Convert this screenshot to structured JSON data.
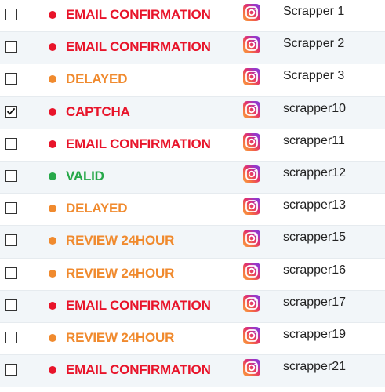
{
  "colors": {
    "red": "#e8142a",
    "orange": "#f08a2e",
    "green": "#27a84a"
  },
  "rows": [
    {
      "checked": false,
      "status": "EMAIL CONFIRMATION",
      "status_color": "red",
      "icon": "instagram-icon",
      "name": "Scrapper 1"
    },
    {
      "checked": false,
      "status": "EMAIL CONFIRMATION",
      "status_color": "red",
      "icon": "instagram-icon",
      "name": "Scrapper 2"
    },
    {
      "checked": false,
      "status": "DELAYED",
      "status_color": "orange",
      "icon": "instagram-icon",
      "name": "Scrapper 3"
    },
    {
      "checked": true,
      "status": "CAPTCHA",
      "status_color": "red",
      "icon": "instagram-icon",
      "name": "scrapper10"
    },
    {
      "checked": false,
      "status": "EMAIL CONFIRMATION",
      "status_color": "red",
      "icon": "instagram-icon",
      "name": "scrapper11"
    },
    {
      "checked": false,
      "status": "VALID",
      "status_color": "green",
      "icon": "instagram-icon",
      "name": "scrapper12"
    },
    {
      "checked": false,
      "status": "DELAYED",
      "status_color": "orange",
      "icon": "instagram-icon",
      "name": "scrapper13"
    },
    {
      "checked": false,
      "status": "REVIEW 24HOUR",
      "status_color": "orange",
      "icon": "instagram-icon",
      "name": "scrapper15"
    },
    {
      "checked": false,
      "status": "REVIEW 24HOUR",
      "status_color": "orange",
      "icon": "instagram-icon",
      "name": "scrapper16"
    },
    {
      "checked": false,
      "status": "EMAIL CONFIRMATION",
      "status_color": "red",
      "icon": "instagram-icon",
      "name": "scrapper17"
    },
    {
      "checked": false,
      "status": "REVIEW 24HOUR",
      "status_color": "orange",
      "icon": "instagram-icon",
      "name": "scrapper19"
    },
    {
      "checked": false,
      "status": "EMAIL CONFIRMATION",
      "status_color": "red",
      "icon": "instagram-icon",
      "name": "scrapper21"
    }
  ]
}
